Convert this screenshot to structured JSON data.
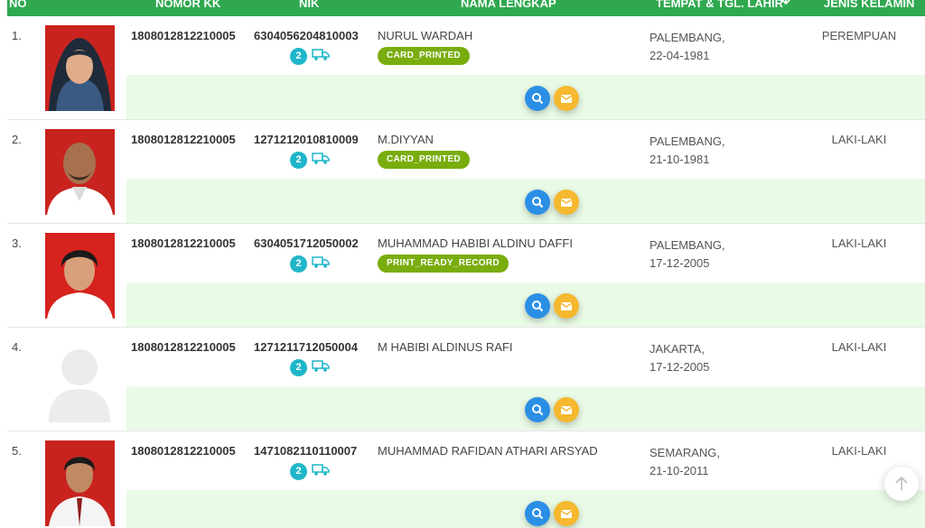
{
  "table": {
    "headers": {
      "no": "NO",
      "nomor_kk": "NOMOR KK",
      "nik": "NIK",
      "nama_lengkap": "NAMA LENGKAP",
      "tempat_lahir": "TEMPAT & TGL. LAHIR",
      "jenis_kelamin": "JENIS KELAMIN"
    },
    "rows": [
      {
        "no": "1.",
        "kk": "1808012812210005",
        "nik": "6304056204810003",
        "count": "2",
        "name": "NURUL WARDAH",
        "status": "CARD_PRINTED",
        "place": "PALEMBANG,",
        "date": "22-04-1981",
        "gender": "PEREMPUAN"
      },
      {
        "no": "2.",
        "kk": "1808012812210005",
        "nik": "1271212010810009",
        "count": "2",
        "name": "M.DIYYAN",
        "status": "CARD_PRINTED",
        "place": "PALEMBANG,",
        "date": "21-10-1981",
        "gender": "LAKI-LAKI"
      },
      {
        "no": "3.",
        "kk": "1808012812210005",
        "nik": "6304051712050002",
        "count": "2",
        "name": "MUHAMMAD HABIBI ALDINU DAFFI",
        "status": "PRINT_READY_RECORD",
        "place": "PALEMBANG,",
        "date": "17-12-2005",
        "gender": "LAKI-LAKI"
      },
      {
        "no": "4.",
        "kk": "1808012812210005",
        "nik": "1271211712050004",
        "count": "2",
        "name": "M HABIBI ALDINUS RAFI",
        "status": "",
        "place": "JAKARTA,",
        "date": "17-12-2005",
        "gender": "LAKI-LAKI"
      },
      {
        "no": "5.",
        "kk": "1808012812210005",
        "nik": "1471082110110007",
        "count": "2",
        "name": "MUHAMMAD RAFIDAN ATHARI ARSYAD",
        "status": "",
        "place": "SEMARANG,",
        "date": "21-10-2011",
        "gender": "LAKI-LAKI"
      }
    ]
  },
  "icons": {
    "count_badge": "count-badge",
    "truck": "truck-icon",
    "search": "search-icon",
    "mail": "mail-icon",
    "sort": "sort-down-arrow-icon",
    "scroll_top": "arrow-up-icon"
  },
  "colors": {
    "header_bg": "#2fa84f",
    "row_action_bg": "#e9fbe6",
    "status_badge": "#79ad0e",
    "count_badge": "#1fb6c9",
    "search_button": "#2b8fe6",
    "mail_button": "#f5b82e"
  }
}
